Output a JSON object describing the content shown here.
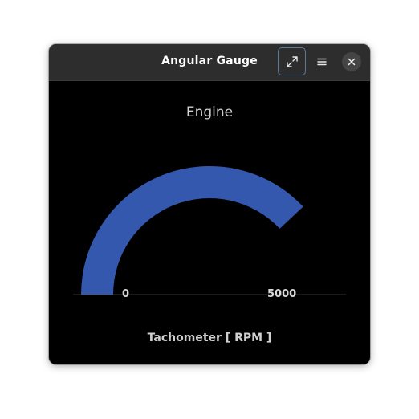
{
  "window": {
    "title": "Angular Gauge",
    "buttons": {
      "expand_icon": "expand-icon",
      "menu_icon": "hamburger-menu-icon",
      "close_icon": "close-icon"
    }
  },
  "gauge": {
    "title": "Engine",
    "subtitle": "Tachometer [ RPM ]",
    "min_label": "0",
    "max_label": "5000",
    "min": 0,
    "max": 5000,
    "value_fraction": 0.76,
    "start_angle_deg": 180,
    "sweep_deg": 180,
    "colors": {
      "background": "#000000",
      "fill": "#3358ad",
      "axis_line": "#333333",
      "text": "#cfcfcf"
    }
  }
}
